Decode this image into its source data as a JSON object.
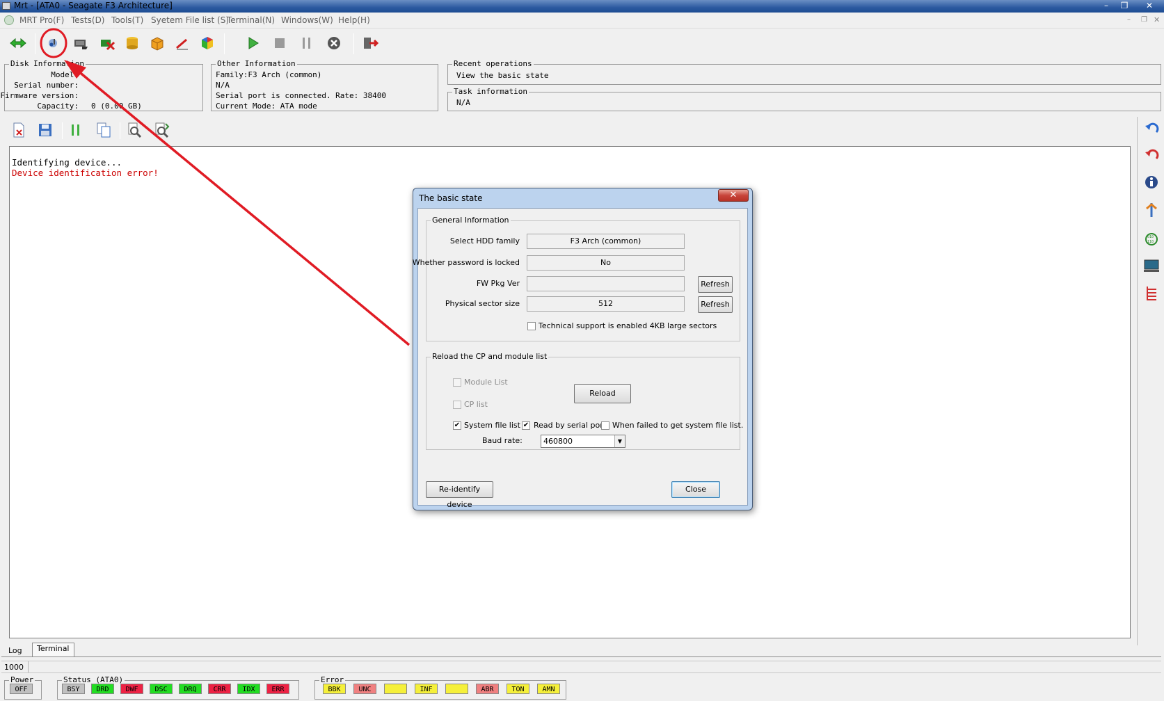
{
  "window": {
    "title": "Mrt - [ATA0 - Seagate F3 Architecture]",
    "controls": {
      "minimize": "–",
      "restore": "❐",
      "close": "✕"
    }
  },
  "menu": {
    "items": [
      "MRT Pro(F)",
      "Tests(D)",
      "Tools(T)",
      "Syetem File list (S)",
      "Terminal(N)",
      "Windows(W)",
      "Help(H)"
    ]
  },
  "toolbar": {
    "icons": [
      "connect-icon",
      "basic-state-icon",
      "device-icon",
      "device-error-icon",
      "disk-stack-icon",
      "box-icon",
      "wand-icon",
      "cube-icon",
      "play-icon",
      "stop-icon",
      "pause-icon",
      "cancel-icon",
      "exit-icon"
    ],
    "highlight_color": "#e01b24"
  },
  "disk_info": {
    "title": "Disk Information",
    "model_label": "Model:",
    "serial_label": "Serial number:",
    "firmware_label": "Firmware version:",
    "capacity_label": "Capacity:",
    "capacity_value": "0 (0.00 GB)"
  },
  "other_info": {
    "title": "Other Information",
    "lines": [
      "Family:F3 Arch (common)",
      "N/A",
      "Serial port is connected. Rate: 38400",
      "Current Mode: ATA mode"
    ]
  },
  "recent_ops": {
    "title": "Recent operations",
    "value": "View the basic state"
  },
  "task_info": {
    "title": "Task information",
    "value": "N/A"
  },
  "log": {
    "lines": [
      {
        "text": "Identifying device...",
        "color": "#000000"
      },
      {
        "text": "Device identification error!",
        "color": "#cc0000"
      }
    ]
  },
  "tabs": [
    "Log",
    "Terminal"
  ],
  "status_line": "1000",
  "power": {
    "title": "Power",
    "indicators": [
      {
        "label": "OFF",
        "color": "#c0c0c0"
      }
    ]
  },
  "status": {
    "title": "Status (ATA0)",
    "indicators": [
      {
        "label": "BSY",
        "color": "#c0c0c0"
      },
      {
        "label": "DRD",
        "color": "#22dd22"
      },
      {
        "label": "DWF",
        "color": "#ee2244"
      },
      {
        "label": "DSC",
        "color": "#22dd22"
      },
      {
        "label": "DRQ",
        "color": "#22dd22"
      },
      {
        "label": "CRR",
        "color": "#ee2244"
      },
      {
        "label": "IDX",
        "color": "#22dd22"
      },
      {
        "label": "ERR",
        "color": "#ee2244"
      }
    ]
  },
  "error": {
    "title": "Error",
    "indicators": [
      {
        "label": "BBK",
        "color": "#f5f03a"
      },
      {
        "label": "UNC",
        "color": "#f08080"
      },
      {
        "label": "",
        "color": "#f5f03a"
      },
      {
        "label": "INF",
        "color": "#f5f03a"
      },
      {
        "label": "",
        "color": "#f5f03a"
      },
      {
        "label": "ABR",
        "color": "#f08080"
      },
      {
        "label": "TON",
        "color": "#f5f03a"
      },
      {
        "label": "AMN",
        "color": "#f5f03a"
      }
    ]
  },
  "dialog": {
    "title": "The basic state",
    "close_glyph": "✕",
    "general": {
      "title": "General Information",
      "hdd_family_label": "Select HDD family",
      "hdd_family_value": "F3 Arch (common)",
      "password_label": "Whether password is locked",
      "password_value": "No",
      "fw_label": "FW Pkg Ver",
      "fw_value": "",
      "sector_label": "Physical sector size",
      "sector_value": "512",
      "refresh_label": "Refresh",
      "tech_support_label": "Technical support is enabled 4KB large sectors",
      "tech_support_checked": false
    },
    "reload": {
      "title": "Reload the CP and module list",
      "module_list_label": "Module List",
      "cp_list_label": "CP list",
      "reload_button": "Reload",
      "system_file_list_label": "System file list",
      "system_file_list_checked": true,
      "read_serial_label": "Read by serial port",
      "read_serial_checked": true,
      "when_failed_label": "When failed to get system file list.",
      "when_failed_checked": false,
      "baud_label": "Baud rate:",
      "baud_value": "460800"
    },
    "reidentify_button": "Re-identify device",
    "close_button": "Close"
  },
  "annotation": {
    "color": "#e01b24"
  }
}
